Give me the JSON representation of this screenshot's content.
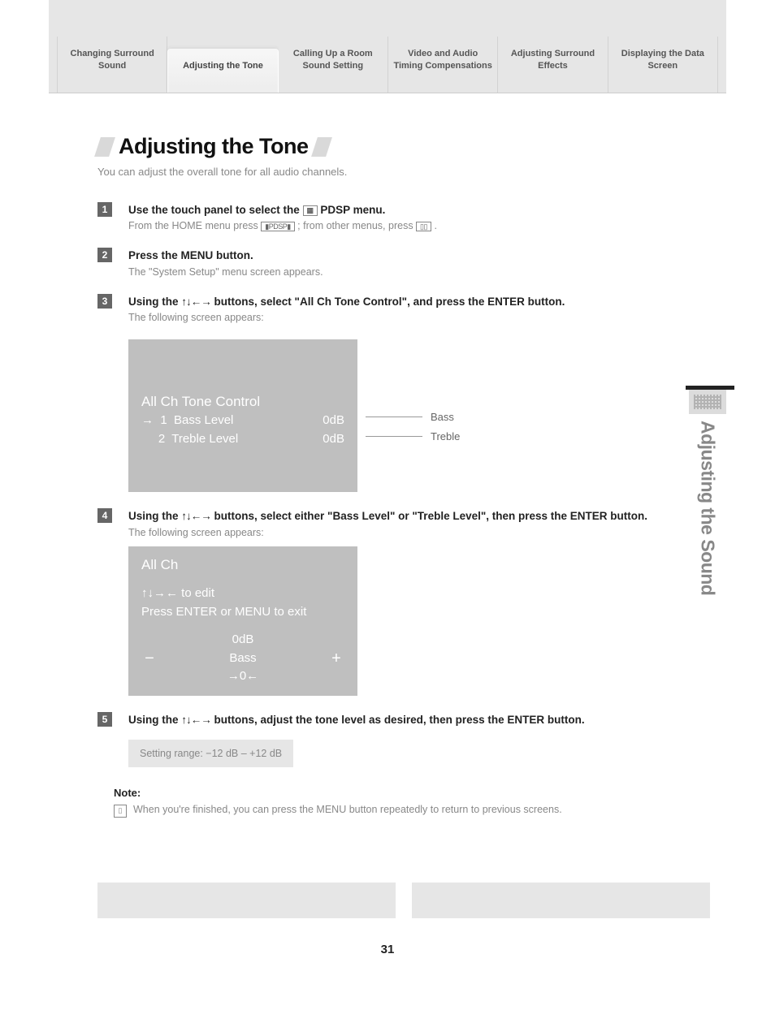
{
  "tabs": [
    {
      "label": "Changing Surround Sound"
    },
    {
      "label": "Adjusting the Tone"
    },
    {
      "label": "Calling Up a Room Sound Setting"
    },
    {
      "label": "Video and Audio Timing Compensations"
    },
    {
      "label": "Adjusting Surround Effects"
    },
    {
      "label": "Displaying the Data Screen"
    }
  ],
  "heading": "Adjusting the Tone",
  "subtitle": "You can adjust the overall tone for all audio channels.",
  "side_label": "Adjusting the Sound",
  "steps": {
    "s1": {
      "num": "1",
      "title_a": "Use the touch panel to select the ",
      "title_b": " PDSP menu.",
      "desc_a": "From the HOME menu press ",
      "desc_b": "; from other menus, press ",
      "desc_c": "."
    },
    "s2": {
      "num": "2",
      "title": "Press the MENU button.",
      "desc": "The \"System Setup\" menu screen appears."
    },
    "s3": {
      "num": "3",
      "title_a": "Using the ",
      "title_b": " buttons, select \"All Ch Tone Control\", and press the ENTER button.",
      "desc": "The following screen appears:",
      "screen": {
        "title": "All Ch Tone Control",
        "row1_left": "→  1  Bass Level",
        "row1_right": "0dB",
        "row2_left": "     2  Treble Level",
        "row2_right": "0dB",
        "callout1": "Bass",
        "callout2": "Treble"
      }
    },
    "s4": {
      "num": "4",
      "title_a": "Using the ",
      "title_b": " buttons, select either \"Bass Level\" or \"Treble Level\", then press the ENTER button.",
      "desc": "The following screen appears:",
      "screen": {
        "line1": "All Ch",
        "line2": "↑↓→← to edit",
        "line3": "Press ENTER or MENU to exit",
        "value": "0dB",
        "label": "Bass",
        "indicator": "→0←",
        "minus": "−",
        "plus": "+"
      }
    },
    "s5": {
      "num": "5",
      "title_a": "Using the ",
      "title_b": " buttons, adjust the tone level as desired, then press the ENTER button.",
      "range": "Setting range: −12 dB – +12 dB"
    }
  },
  "note": {
    "label": "Note:",
    "body": "When you're finished, you can press the MENU button repeatedly to return to previous screens."
  },
  "page_number": "31",
  "arrow_glyphs": "↑↓←→",
  "icon_labels": {
    "pdsp_btn": "▮PDSP▮",
    "nav_btn": "▯▯"
  }
}
